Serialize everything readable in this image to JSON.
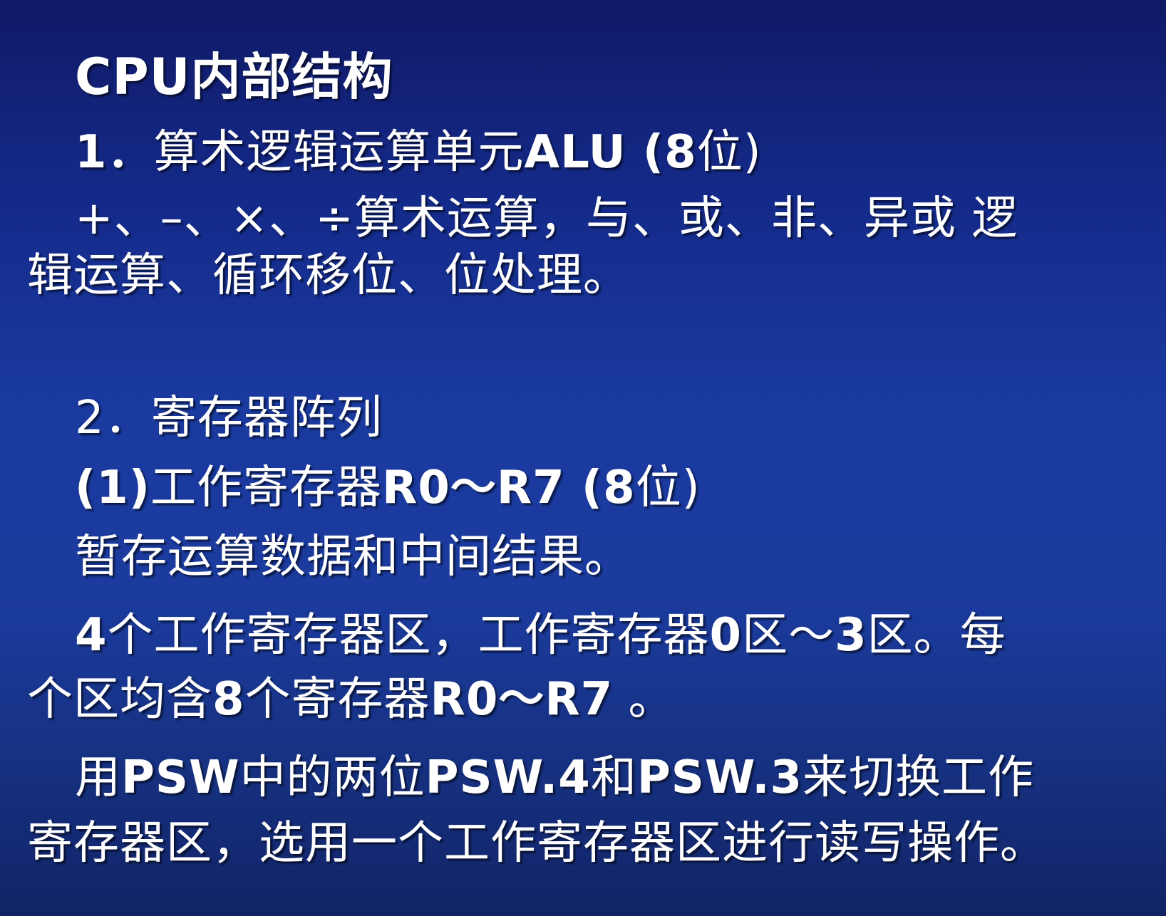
{
  "slide": {
    "title": "CPU内部结构",
    "lines": {
      "l1": [
        "1．",
        "算术逻辑运算单元",
        "ALU (8",
        "位)"
      ],
      "l2": "+、–、×、÷算术运算，与、或、非、异或 逻",
      "l3": "辑运算、循环移位、位处理。",
      "l4": "2．寄存器阵列",
      "l5": [
        "(1)",
        "工作寄存器",
        "R0～R7 (8",
        "位)"
      ],
      "l6": "暂存运算数据和中间结果。",
      "l7": [
        "4",
        "个工作寄存器区，工作寄存器",
        "0",
        "区～",
        "3",
        "区。每"
      ],
      "l8": [
        "个区均含",
        "8",
        "个寄存器",
        "R0～R7",
        " 。"
      ],
      "l9": [
        "用",
        "PSW",
        "中的两位",
        "PSW.4",
        "和",
        "PSW.3",
        "来切换工作"
      ],
      "l10": "寄存器区，选用一个工作寄存器区进行读写操作。"
    }
  },
  "colors": {
    "background_top": "#101a66",
    "background_mid": "#1a3aa0",
    "text": "#ffffff"
  }
}
